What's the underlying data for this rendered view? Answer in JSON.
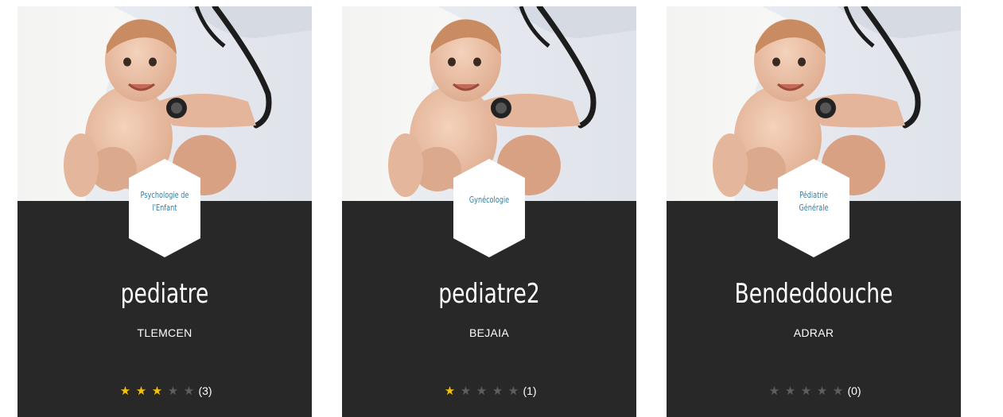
{
  "cards": [
    {
      "specialty": "Psychologie de\nl'Enfant",
      "name": "pediatre",
      "city": "TLEMCEN",
      "rating": 3,
      "max_rating": 5,
      "count": "(3)"
    },
    {
      "specialty": "Gynécologie",
      "name": "pediatre2",
      "city": "BEJAIA",
      "rating": 1,
      "max_rating": 5,
      "count": "(1)"
    },
    {
      "specialty": "Pédiatrie\nGénérale",
      "name": "Bendeddouche",
      "city": "ADRAR",
      "rating": 0,
      "max_rating": 5,
      "count": "(0)"
    }
  ],
  "icons": {
    "star": "star-icon"
  },
  "colors": {
    "card_bg": "#282828",
    "star_on": "#f4c20d",
    "star_off": "#5e5e5e",
    "specialty_text": "#2e7ea6"
  }
}
